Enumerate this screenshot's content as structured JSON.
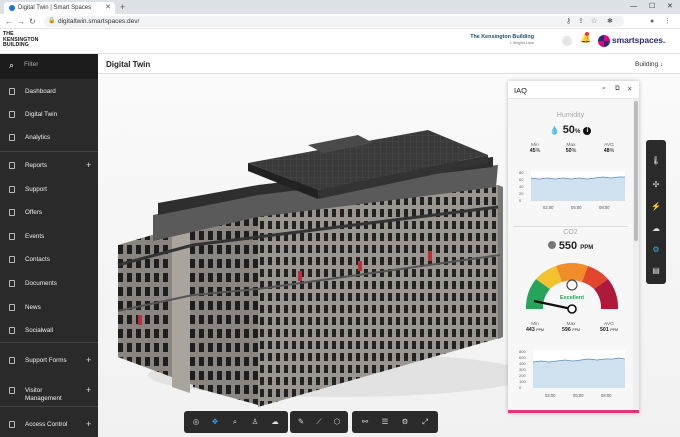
{
  "browser": {
    "tab_title": "Digital Twin | Smart Spaces",
    "url": "digitaltwin.smartspaces.dev/"
  },
  "header": {
    "logo_line1": "THE",
    "logo_line2": "KENSINGTON",
    "logo_line3": "BUILDING",
    "building_name": "The Kensington Building",
    "building_sub": "1 Wrights Lane",
    "brand": "smartspaces."
  },
  "sidebar": {
    "filter_placeholder": "Filter",
    "items": [
      {
        "label": "Dashboard"
      },
      {
        "label": "Digital Twin"
      },
      {
        "label": "Analytics"
      },
      {
        "label": "Reports",
        "plus": "+"
      },
      {
        "label": "Support"
      },
      {
        "label": "Offers"
      },
      {
        "label": "Events"
      },
      {
        "label": "Contacts"
      },
      {
        "label": "Documents"
      },
      {
        "label": "News"
      },
      {
        "label": "Socialwall"
      },
      {
        "label": "Support Forms",
        "plus": "+"
      },
      {
        "label": "Visitor Management",
        "plus": "+"
      },
      {
        "label": "Access Control",
        "plus": "+"
      }
    ]
  },
  "main": {
    "title": "Digital Twin",
    "building_selector": "Building"
  },
  "iaq": {
    "title": "IAQ",
    "humidity": {
      "title": "Humidity",
      "value": "50",
      "unit": "%",
      "min_label": "Min",
      "min": "45",
      "min_unit": "%",
      "max_label": "Max",
      "max": "50",
      "max_unit": "%",
      "avg_label": "AVG",
      "avg": "48",
      "avg_unit": "%",
      "y_ticks": [
        "80",
        "60",
        "40",
        "20",
        "0"
      ],
      "x_ticks": [
        "02:00",
        "05:00",
        "08:00"
      ]
    },
    "co2": {
      "title": "CO2",
      "value": "550",
      "unit": "PPM",
      "status": "Excellent",
      "min_label": "Min",
      "min": "443",
      "min_unit": "PPM",
      "max_label": "Max",
      "max": "596",
      "max_unit": "PPM",
      "avg_label": "AVG",
      "avg": "501",
      "avg_unit": "PPM",
      "y_ticks": [
        "800",
        "600",
        "400",
        "300",
        "200",
        "100",
        "0"
      ],
      "x_ticks": [
        "02:00",
        "05:00",
        "08:00"
      ]
    }
  },
  "colors": {
    "sidebar": "#2a2a2a",
    "accent": "#e6327a",
    "chart_line": "#5b8db8"
  }
}
